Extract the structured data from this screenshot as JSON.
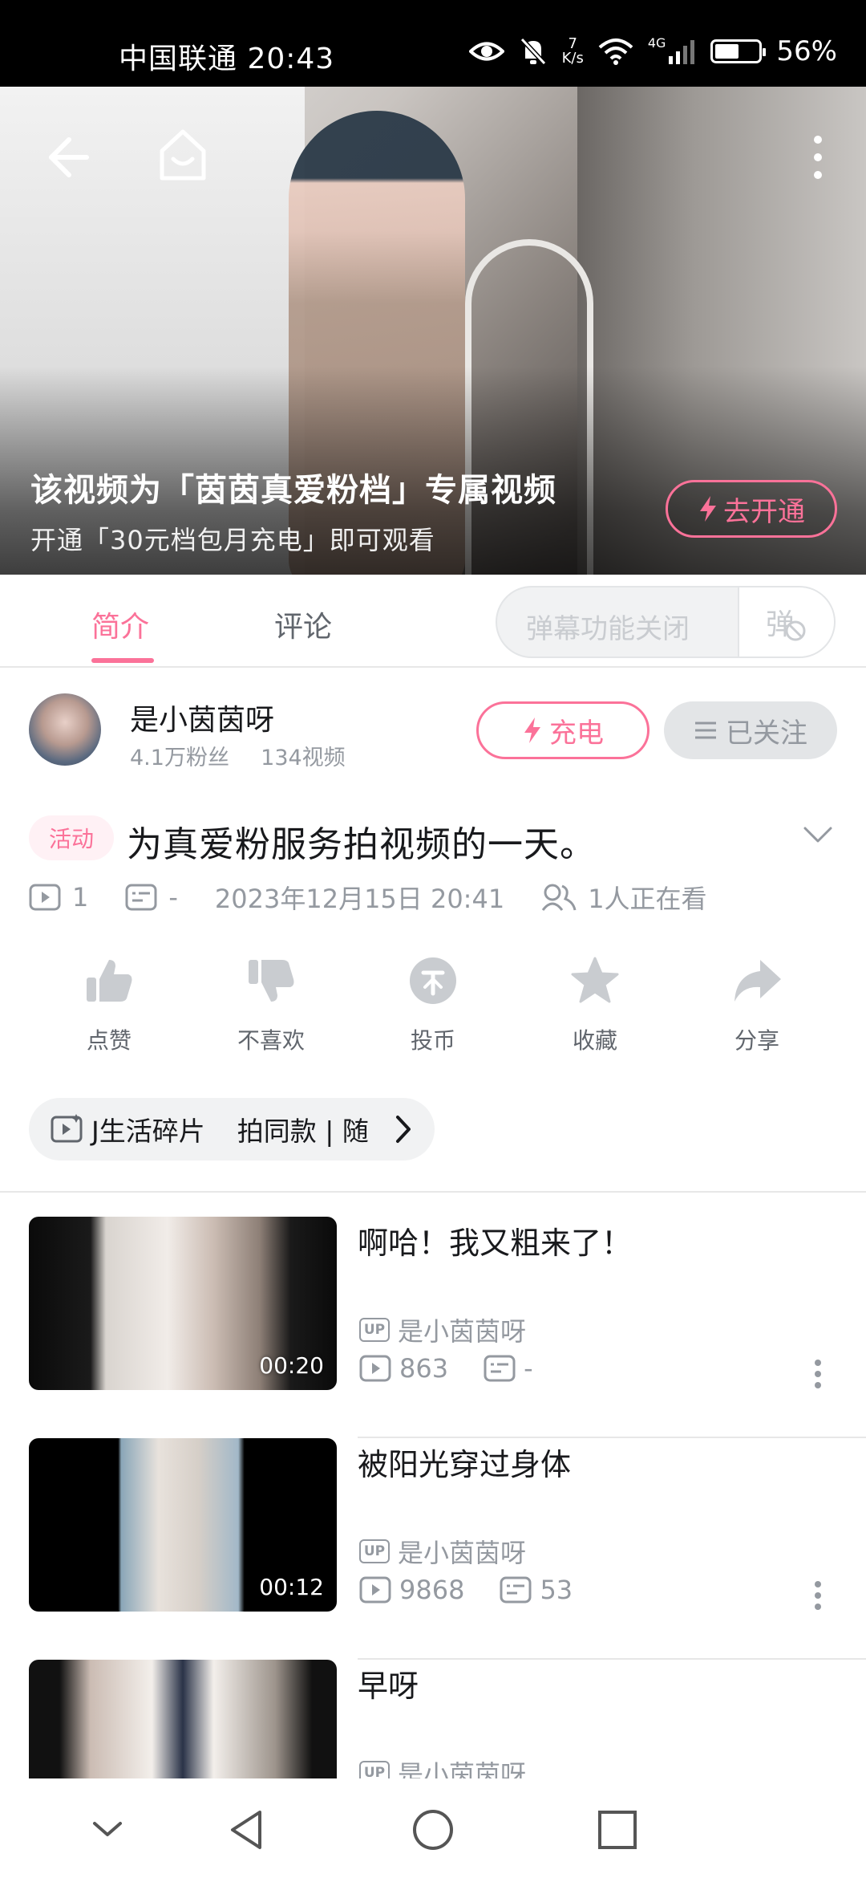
{
  "status_bar": {
    "carrier_time": "中国联通 20:43",
    "net_speed_value": "7",
    "net_speed_unit": "K/s",
    "network": "4G",
    "battery_percent": "56%",
    "battery_level": 0.56
  },
  "player": {
    "locked_title": "该视频为「茵茵真爱粉档」专属视频",
    "locked_subtitle": "开通「30元档包月充电」即可观看",
    "open_button": "去开通"
  },
  "tabs": {
    "intro": "简介",
    "comments": "评论",
    "danmaku_placeholder": "弹幕功能关闭",
    "danmaku_toggle": "弹"
  },
  "uploader": {
    "name": "是小茵茵呀",
    "fans": "4.1万粉丝",
    "videos": "134视频",
    "charge_button": "充电",
    "follow_button": "已关注"
  },
  "video": {
    "tag": "活动",
    "title": "为真爱粉服务拍视频的一天。",
    "plays": "1",
    "danmaku": "-",
    "date": "2023年12月15日 20:41",
    "watching": "1人正在看"
  },
  "actions": {
    "like": "点赞",
    "dislike": "不喜欢",
    "coin": "投币",
    "favorite": "收藏",
    "share": "分享"
  },
  "collection": {
    "title": "J生活碎片",
    "extra": "拍同款 | 随"
  },
  "recommendations": [
    {
      "title": "啊哈！我又粗来了！",
      "uploader": "是小茵茵呀",
      "plays": "863",
      "danmaku": "-",
      "duration": "00:20"
    },
    {
      "title": "被阳光穿过身体",
      "uploader": "是小茵茵呀",
      "plays": "9868",
      "danmaku": "53",
      "duration": "00:12"
    },
    {
      "title": "早呀",
      "uploader": "是小茵茵呀",
      "plays": "",
      "danmaku": "",
      "duration": ""
    }
  ],
  "colors": {
    "accent": "#fb7299",
    "text_primary": "#18191c",
    "text_secondary": "#9499a0"
  }
}
